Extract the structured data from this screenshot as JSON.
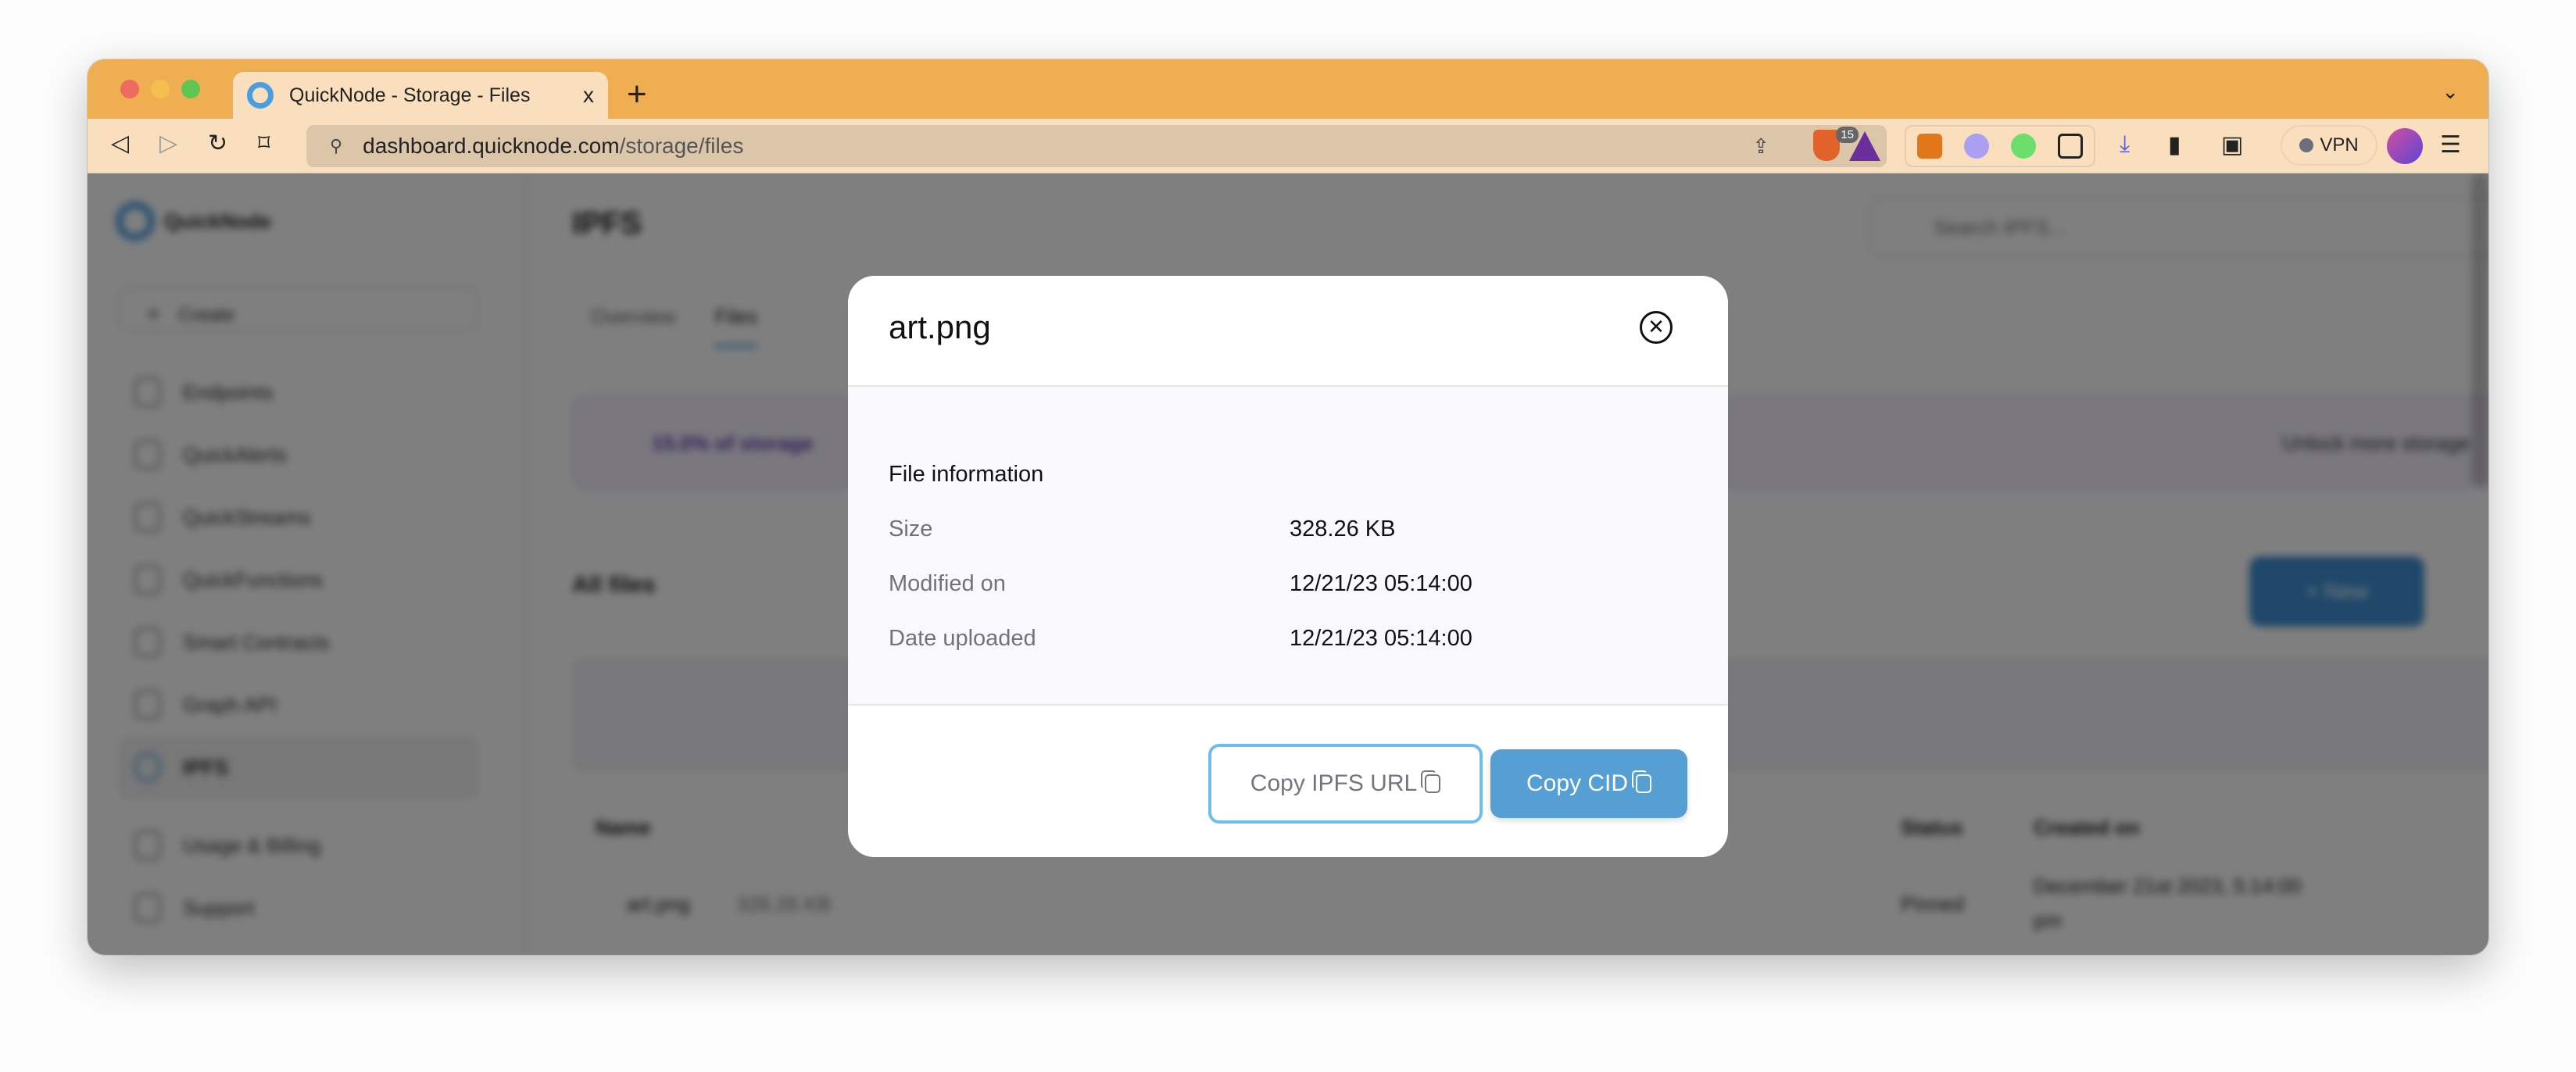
{
  "browser": {
    "tab_title": "QuickNode - Storage - Files",
    "url_host": "dashboard.quicknode.com",
    "url_path": "/storage/files",
    "shields_count": "15",
    "vpn_label": "VPN",
    "tab_close": "x",
    "new_tab": "+"
  },
  "sidebar": {
    "logo": "QuickNode",
    "create_label": "Create",
    "items": [
      {
        "label": "Endpoints"
      },
      {
        "label": "QuickAlerts"
      },
      {
        "label": "QuickStreams"
      },
      {
        "label": "QuickFunctions"
      },
      {
        "label": "Smart Contracts"
      },
      {
        "label": "Graph API"
      },
      {
        "label": "IPFS"
      },
      {
        "label": "Usage & Billing"
      },
      {
        "label": "Support"
      }
    ]
  },
  "main": {
    "title": "IPFS",
    "search_placeholder": "Search IPFS...",
    "tabs": [
      {
        "label": "Overview"
      },
      {
        "label": "Files"
      }
    ],
    "alert_text": "15.0% of storage",
    "alert_action": "Unlock more storage",
    "files_heading": "All files",
    "new_button": "+ New",
    "table": {
      "headers": [
        "Name",
        "Status",
        "Created on"
      ],
      "row": {
        "name": "art.png",
        "size": "328.26 KB",
        "status": "Pinned",
        "created": "December 21st 2023, 5:14:00 pm"
      }
    }
  },
  "modal": {
    "title": "art.png",
    "section_title": "File information",
    "fields": [
      {
        "label": "Size",
        "value": "328.26 KB"
      },
      {
        "label": "Modified on",
        "value": "12/21/23 05:14:00"
      },
      {
        "label": "Date uploaded",
        "value": "12/21/23 05:14:00"
      }
    ],
    "copy_url_label": "Copy IPFS URL",
    "copy_cid_label": "Copy CID",
    "close_glyph": "✕"
  },
  "colors": {
    "titlebar": "#f0ae53",
    "toolbar": "#f9dfbd",
    "primary_button": "#559fd5",
    "outline_button_border": "#6cbdf0"
  }
}
